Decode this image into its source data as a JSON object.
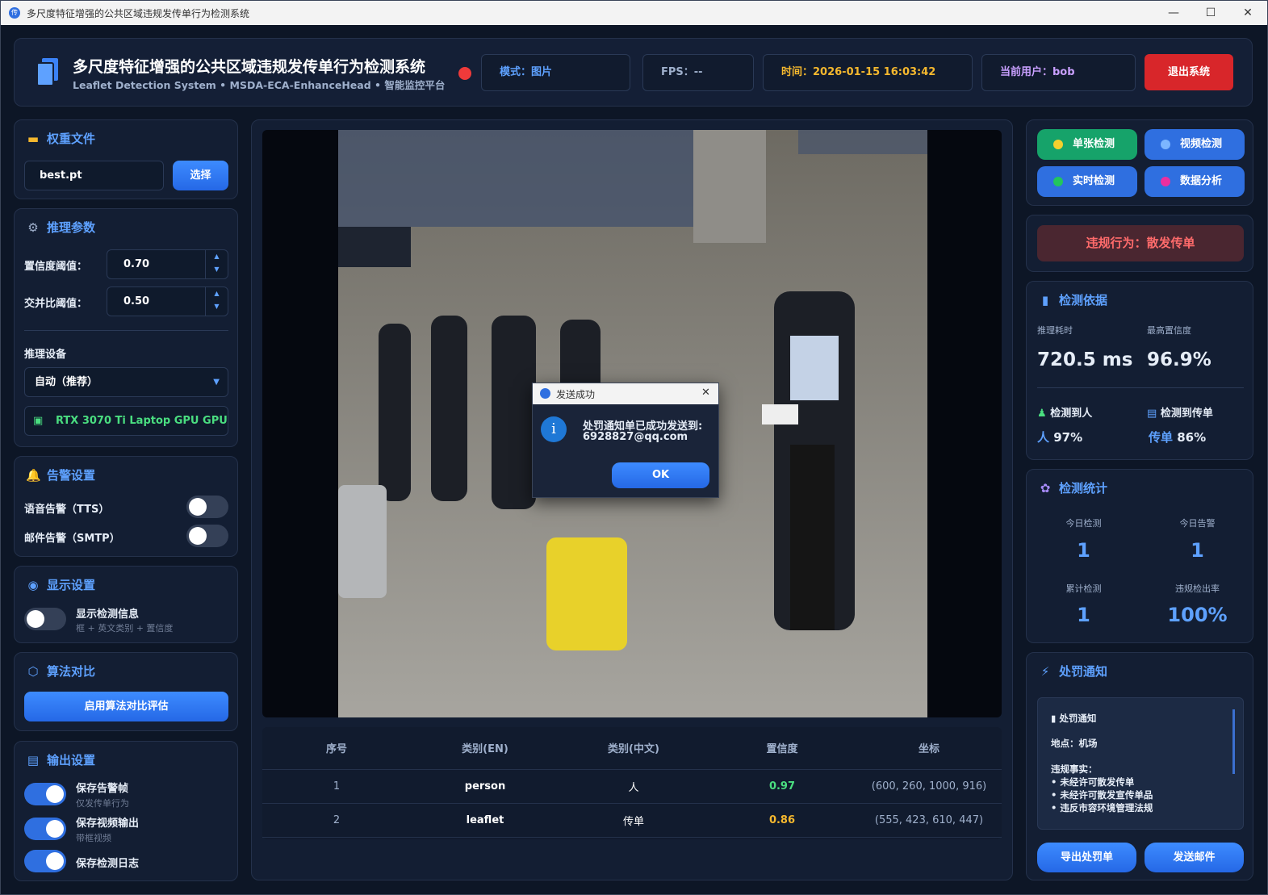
{
  "window": {
    "title": "多尺度特征增强的公共区域违规发传单行为检测系统",
    "app_icon": "传",
    "min": "—",
    "max": "☐",
    "close": "✕"
  },
  "header": {
    "title": "多尺度特征增强的公共区域违规发传单行为检测系统",
    "subtitle": "Leaflet Detection System • MSDA-ECA-EnhanceHead • 智能监控平台",
    "mode": "模式：图片",
    "fps": "FPS：--",
    "time": "时间：2026-01-15 16:03:42",
    "user": "当前用户：bob",
    "logout": "退出系统"
  },
  "weights": {
    "title": "权重文件",
    "file": "best.pt",
    "select": "选择"
  },
  "params": {
    "title": "推理参数",
    "conf_label": "置信度阈值：",
    "conf_value": "0.70",
    "iou_label": "交并比阈值：",
    "iou_value": "0.50",
    "device_label": "推理设备",
    "device_value": "自动（推荐）",
    "gpu": "RTX 3070 Ti Laptop GPU GPU"
  },
  "alarm": {
    "title": "告警设置",
    "tts": "语音告警（TTS）",
    "smtp": "邮件告警（SMTP）"
  },
  "display": {
    "title": "显示设置",
    "show_info": "显示检测信息",
    "show_info_sub": "框 + 英文类别 + 置信度"
  },
  "algo": {
    "title": "算法对比",
    "button": "启用算法对比评估"
  },
  "output": {
    "title": "输出设置",
    "save_frames": "保存告警帧",
    "save_frames_sub": "仅发传单行为",
    "save_video": "保存视频输出",
    "save_video_sub": "带框视频",
    "save_log": "保存检测日志"
  },
  "modes": {
    "single": "单张检测",
    "video": "视频检测",
    "realtime": "实时检测",
    "analysis": "数据分析"
  },
  "violation": "违规行为：散发传单",
  "basis": {
    "title": "检测依据",
    "time_label": "推理耗时",
    "time_value": "720.5 ms",
    "conf_label": "最高置信度",
    "conf_value": "96.9%",
    "person_label": "检测到人",
    "person_name": "人",
    "person_pct": "97%",
    "leaflet_label": "检测到传单",
    "leaflet_name": "传单",
    "leaflet_pct": "86%"
  },
  "stats": {
    "title": "检测统计",
    "today_label": "今日检测",
    "today_value": "1",
    "alarm_label": "今日告警",
    "alarm_value": "1",
    "total_label": "累计检测",
    "total_value": "1",
    "rate_label": "违规检出率",
    "rate_value": "100%"
  },
  "penalty": {
    "title": "处罚通知",
    "heading": "处罚通知",
    "place": "地点：机场",
    "facts_label": "违规事实：",
    "facts": [
      "• 未经许可散发传单",
      "• 未经许可散发宣传单品",
      "• 违反市容环境管理法规"
    ],
    "export": "导出处罚单",
    "email": "发送邮件"
  },
  "table": {
    "headers": [
      "序号",
      "类别(EN)",
      "类别(中文)",
      "置信度",
      "坐标"
    ],
    "rows": [
      [
        "1",
        "person",
        "人",
        "0.97",
        "(600, 260, 1000, 916)"
      ],
      [
        "2",
        "leaflet",
        "传单",
        "0.86",
        "(555, 423, 610, 447)"
      ]
    ]
  },
  "dialog": {
    "title": "发送成功",
    "message": "处罚通知单已成功发送到:",
    "email": "6928827@qq.com",
    "ok": "OK"
  },
  "colors": {
    "accent": "#2f6fe0",
    "danger": "#e02a2a",
    "conf_person": "#4ade80",
    "conf_leaflet": "#f5b82e",
    "time": "#f5b82e",
    "user": "#c9a0ff"
  }
}
